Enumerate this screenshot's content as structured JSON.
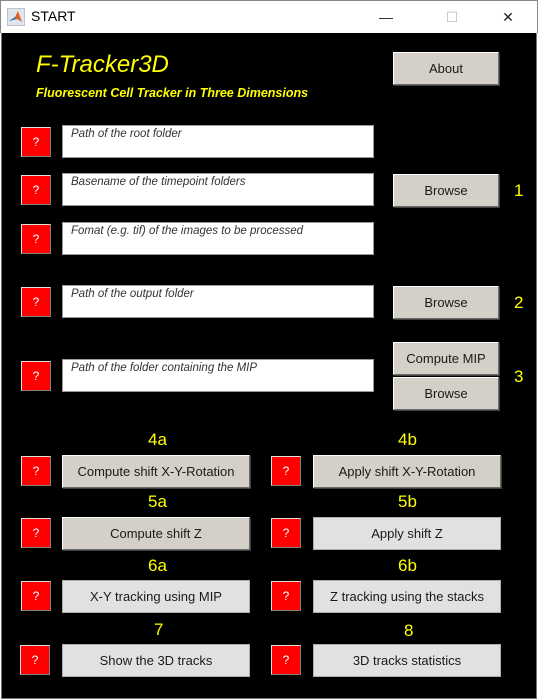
{
  "window": {
    "title": "START",
    "icon": "matlab-icon",
    "controls": {
      "minimize": "—",
      "maximize": "☐",
      "close": "✕"
    }
  },
  "header": {
    "title": "F-Tracker3D",
    "subtitle": "Fluorescent Cell Tracker in Three Dimensions",
    "about_label": "About"
  },
  "help_label": "?",
  "fields": [
    {
      "placeholder": "Path of the root folder"
    },
    {
      "placeholder": "Basename of the timepoint folders"
    },
    {
      "placeholder": "Fomat (e.g. tif) of the images to be processed"
    },
    {
      "placeholder": "Path of the output folder"
    },
    {
      "placeholder": "Path of the folder containing the MIP"
    }
  ],
  "side_buttons": {
    "browse1": "Browse",
    "browse2": "Browse",
    "compute_mip": "Compute MIP",
    "browse3": "Browse"
  },
  "step_numbers": {
    "s1": "1",
    "s2": "2",
    "s3": "3",
    "s4a": "4a",
    "s4b": "4b",
    "s5a": "5a",
    "s5b": "5b",
    "s6a": "6a",
    "s6b": "6b",
    "s7": "7",
    "s8": "8"
  },
  "steps": {
    "s4a": "Compute shift X-Y-Rotation",
    "s4b": "Apply shift X-Y-Rotation",
    "s5a": "Compute shift Z",
    "s5b": "Apply shift Z",
    "s6a": "X-Y tracking using MIP",
    "s6b": "Z tracking using the stacks",
    "s7": "Show the 3D tracks",
    "s8": "3D tracks statistics"
  },
  "colors": {
    "background": "#000000",
    "accent_text": "#ffff00",
    "help_button": "#ff0000",
    "button": "#d4d0c8",
    "button_light": "#e1e1e1"
  }
}
